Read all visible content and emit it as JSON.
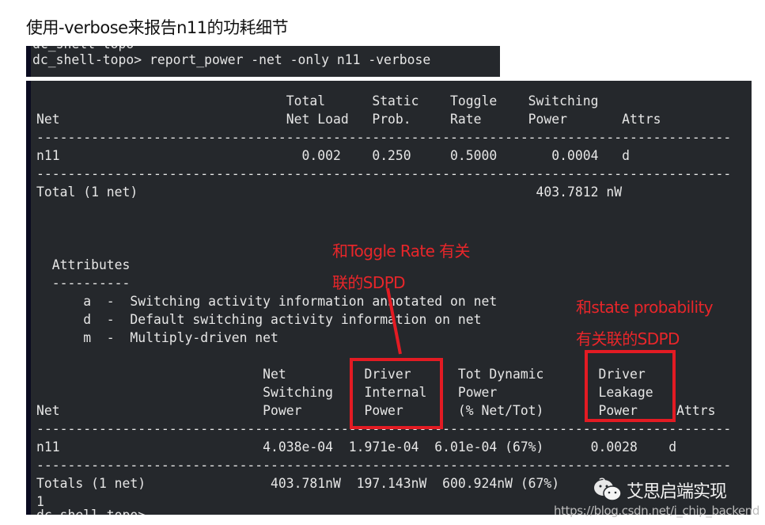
{
  "caption": "使用-verbose来报告n11的功耗细节",
  "command_terminal": {
    "clipped_prev_line": "dc_shell-topo",
    "command_line": "dc_shell-topo> report_power -net -only n11 -verbose"
  },
  "report": {
    "lines": [
      "                                Total      Static    Toggle    Switching",
      "Net                             Net Load   Prob.     Rate      Power       Attrs",
      "-----------------------------------------------------------------------------------------",
      "n11                               0.002    0.250     0.5000       0.0004   d",
      "-----------------------------------------------------------------------------------------",
      "Total (1 net)                                                   403.7812 nW",
      "",
      "",
      "",
      "  Attributes",
      "  ----------",
      "      a  -  Switching activity information annotated on net",
      "      d  -  Default switching activity information on net",
      "      m  -  Multiply-driven net",
      "",
      "                             Net          Driver      Tot Dynamic       Driver",
      "                             Switching    Internal    Power             Leakage",
      "Net                          Power        Power       (% Net/Tot)       Power     Attrs",
      "-----------------------------------------------------------------------------------------",
      "n11                          4.038e-04  1.971e-04  6.01e-04 (67%)      0.0028    d",
      "-----------------------------------------------------------------------------------------",
      "Totals (1 net)                403.781nW  197.143nW  600.924nW (67%)     2",
      "1",
      "dc_shell-topo> "
    ]
  },
  "annotations": {
    "toggle_rate_note_line1": "和Toggle Rate 有关",
    "toggle_rate_note_line2": "联的SDPD",
    "state_prob_note_line1": "和state probability",
    "state_prob_note_line2": "有关联的SDPD",
    "color": "#e31b23"
  },
  "watermark": {
    "brand": "艾思启端实现",
    "url": "https://blog.csdn.net/i_chip_backend"
  }
}
